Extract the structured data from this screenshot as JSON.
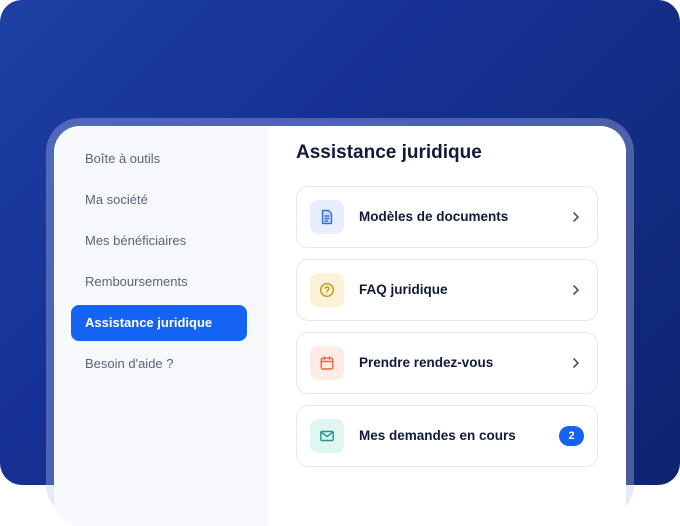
{
  "sidebar": {
    "items": [
      {
        "label": "Boîte à outils",
        "active": false
      },
      {
        "label": "Ma société",
        "active": false
      },
      {
        "label": "Mes bénéficiaires",
        "active": false
      },
      {
        "label": "Remboursements",
        "active": false
      },
      {
        "label": "Assistance juridique",
        "active": true
      },
      {
        "label": "Besoin d'aide ?",
        "active": false
      }
    ]
  },
  "main": {
    "title": "Assistance juridique",
    "cards": [
      {
        "label": "Modèles de documents",
        "icon": "document-icon",
        "icon_color": "#3b6fd8",
        "icon_bg": "#e7eefc"
      },
      {
        "label": "FAQ juridique",
        "icon": "question-icon",
        "icon_color": "#c9930b",
        "icon_bg": "#fdf2d8"
      },
      {
        "label": "Prendre rendez-vous",
        "icon": "calendar-icon",
        "icon_color": "#e26a4a",
        "icon_bg": "#fdebe5"
      },
      {
        "label": "Mes demandes en cours",
        "icon": "mail-icon",
        "icon_color": "#1c9c8a",
        "icon_bg": "#e1f5f1",
        "badge": "2"
      }
    ]
  },
  "colors": {
    "accent": "#1463f3",
    "background_gradient_start": "#1e3fa3",
    "background_gradient_end": "#0e246f"
  }
}
